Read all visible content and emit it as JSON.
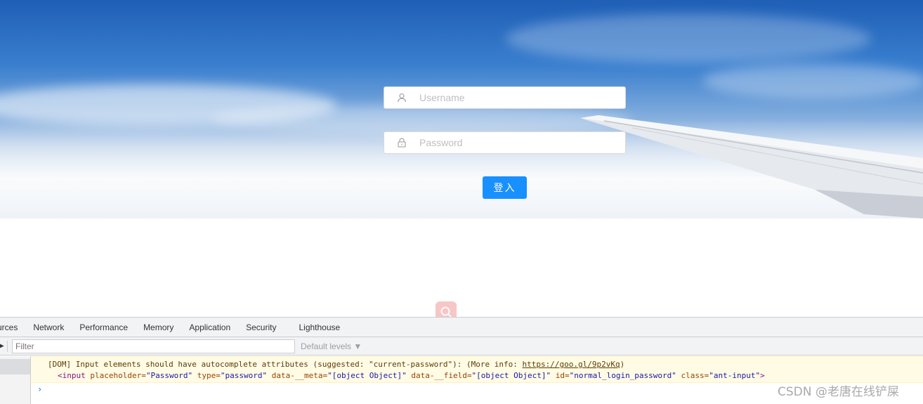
{
  "login": {
    "username_placeholder": "Username",
    "password_placeholder": "Password",
    "submit_label": "登入",
    "username_icon": "user-icon",
    "password_icon": "lock-icon"
  },
  "floating": {
    "search_icon": "search-icon",
    "color": "#f7c6c6"
  },
  "devtools": {
    "tabs": [
      "urces",
      "Network",
      "Performance",
      "Memory",
      "Application",
      "Security",
      "Lighthouse"
    ],
    "filter_placeholder": "Filter",
    "levels_label": "Default levels ▼",
    "warning": {
      "line1_text": "[DOM] Input elements should have autocomplete attributes (suggested: \"current-password\"): (More info: ",
      "line1_link": "https://goo.gl/9p2vKq",
      "line1_end": ")",
      "tag_open": "<input",
      "a1_name": "placeholder=",
      "a1_val": "\"Password\"",
      "a2_name": "type=",
      "a2_val": "\"password\"",
      "a3_name": "data-__meta=",
      "a3_val": "\"[object Object]\"",
      "a4_name": "data-__field=",
      "a4_val": "\"[object Object]\"",
      "a5_name": "id=",
      "a5_val": "\"normal_login_password\"",
      "a6_name": "class=",
      "a6_val": "\"ant-input\"",
      "tag_close": ">"
    },
    "prompt": "›"
  },
  "watermark": "CSDN @老唐在线铲屎",
  "colors": {
    "primary": "#1890ff",
    "warning_bg": "#fffbe5",
    "sky": "#1f5fb6"
  }
}
